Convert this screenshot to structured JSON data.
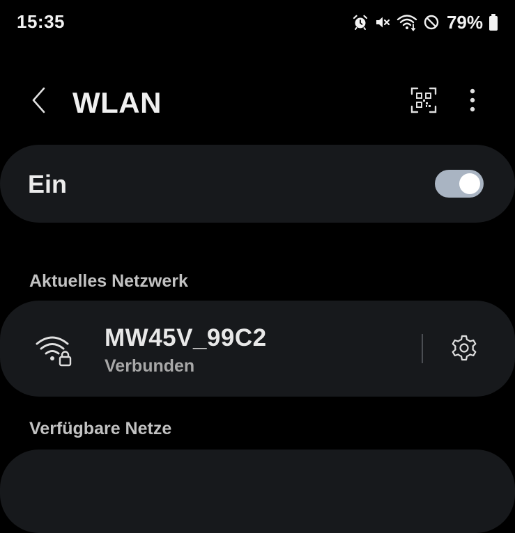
{
  "status_bar": {
    "time": "15:35",
    "battery_percent": "79%",
    "icons": [
      "alarm-icon",
      "mute-icon",
      "wifi-status-icon",
      "dnd-icon",
      "battery-icon"
    ]
  },
  "app_bar": {
    "title": "WLAN",
    "back_icon": "chevron-left-icon",
    "qr_icon": "qr-scan-icon",
    "more_icon": "more-vert-icon"
  },
  "master_switch": {
    "label": "Ein",
    "checked": true,
    "track_color": "#a9b4c2"
  },
  "current_network": {
    "header": "Aktuelles Netzwerk",
    "ssid": "MW45V_99C2",
    "status": "Verbunden",
    "icon": "wifi-lock-icon",
    "settings_icon": "gear-icon"
  },
  "available_networks": {
    "header": "Verfügbare Netze"
  },
  "colors": {
    "background": "#000000",
    "card": "#17191c",
    "text_primary": "#e8e8e8",
    "text_secondary": "#a8a8a8"
  }
}
